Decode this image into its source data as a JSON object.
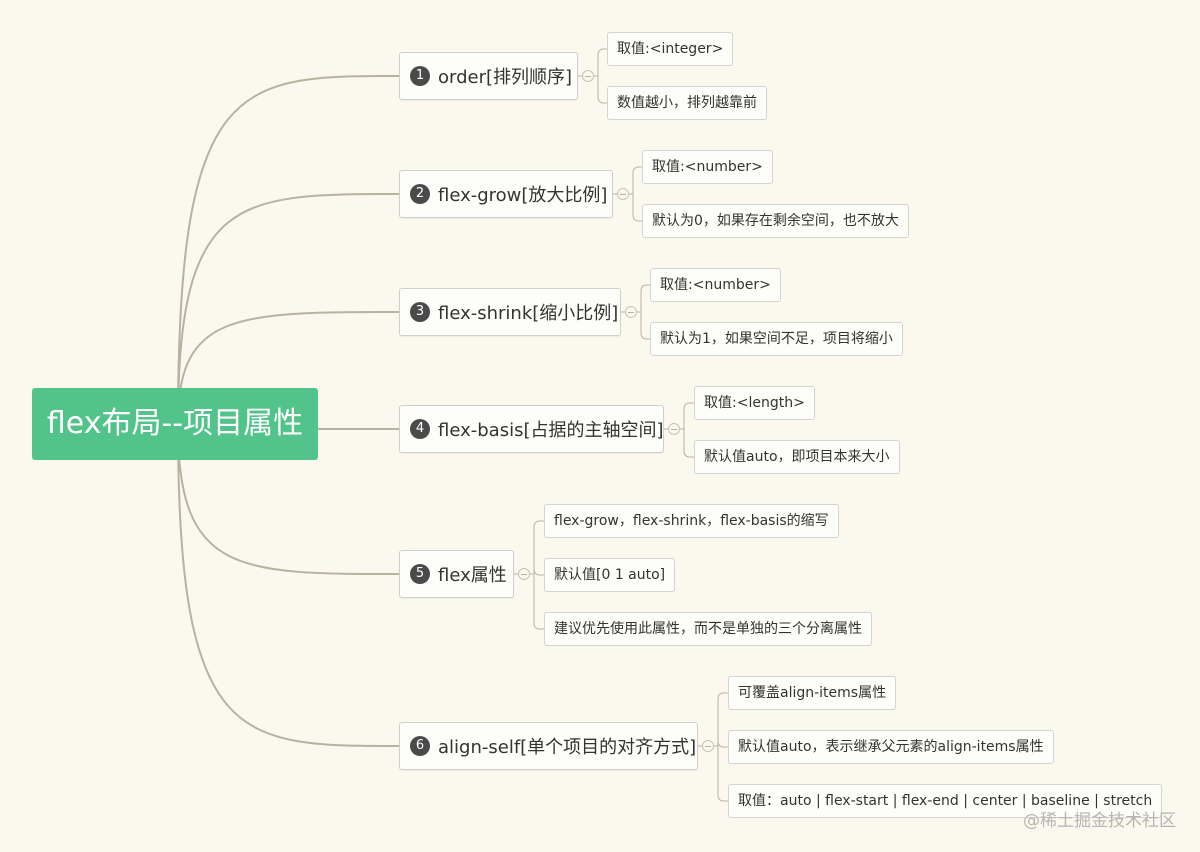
{
  "root": {
    "label": "flex布局--项目属性",
    "color": "#52c38a"
  },
  "branches": [
    {
      "num": "1",
      "label": "order[排列顺序]",
      "children": [
        "取值:<integer>",
        "数值越小，排列越靠前"
      ]
    },
    {
      "num": "2",
      "label": "flex-grow[放大比例]",
      "children": [
        "取值:<number>",
        "默认为0，如果存在剩余空间，也不放大"
      ]
    },
    {
      "num": "3",
      "label": "flex-shrink[缩小比例]",
      "children": [
        "取值:<number>",
        "默认为1，如果空间不足，项目将缩小"
      ]
    },
    {
      "num": "4",
      "label": "flex-basis[占据的主轴空间]",
      "children": [
        "取值:<length>",
        "默认值auto，即项目本来大小"
      ]
    },
    {
      "num": "5",
      "label": "flex属性",
      "children": [
        "flex-grow，flex-shrink，flex-basis的缩写",
        "默认值[0 1 auto]",
        "建议优先使用此属性，而不是单独的三个分离属性"
      ]
    },
    {
      "num": "6",
      "label": "align-self[单个项目的对齐方式]",
      "children": [
        "可覆盖align-items属性",
        "默认值auto，表示继承父元素的align-items属性",
        "取值：auto | flex-start | flex-end | center | baseline | stretch"
      ]
    }
  ],
  "watermark": "@稀土掘金技术社区",
  "colors": {
    "background": "#fbf8ee",
    "connector": "#b8b2a0",
    "root": "#52c38a",
    "badge": "#4a4a4a"
  }
}
